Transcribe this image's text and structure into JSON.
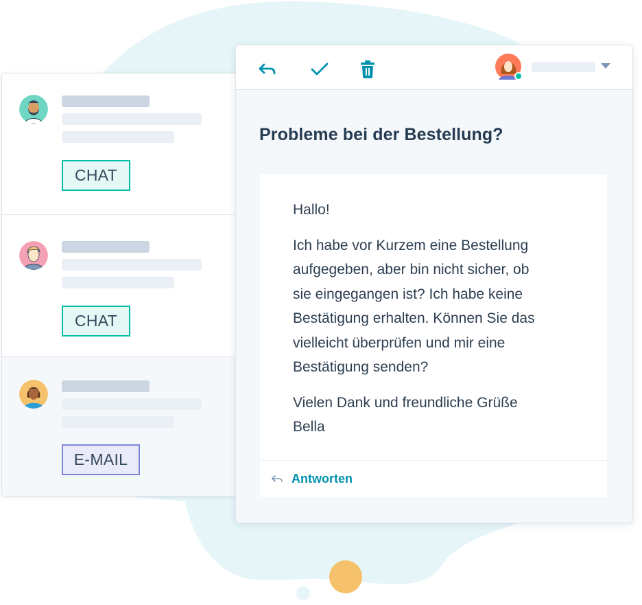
{
  "colors": {
    "accent": "#0091ae",
    "chat_border": "#00bda5",
    "chat_bg": "#e5f8f6",
    "email_border": "#7c86d9",
    "email_bg": "#eaebf8",
    "online": "#00bda5",
    "blob": "#e5f5f8",
    "orange_dot": "#f5c26b"
  },
  "conversations": [
    {
      "avatar": "bearded-man-avatar",
      "channel": "CHAT",
      "active": false
    },
    {
      "avatar": "blond-man-avatar",
      "channel": "CHAT",
      "active": false
    },
    {
      "avatar": "woman-avatar",
      "channel": "E-MAIL",
      "active": true
    }
  ],
  "toolbar": {
    "reply_icon": "reply-arrow-icon",
    "done_icon": "checkmark-icon",
    "delete_icon": "trash-icon",
    "owner_status": "online"
  },
  "message": {
    "subject": "Probleme bei der Bestellung?",
    "greeting": "Hallo!",
    "body_lines": [
      "Ich habe vor Kurzem eine Bestellung",
      "aufgegeben, aber bin nicht sicher, ob",
      "sie eingegangen ist? Ich habe keine",
      "Bestätigung erhalten. Können Sie das",
      "vielleicht überprüfen und mir eine",
      "Bestätigung senden?"
    ],
    "closing": "Vielen Dank und freundliche Grüße",
    "signature": "Bella",
    "reply_label": "Antworten"
  }
}
